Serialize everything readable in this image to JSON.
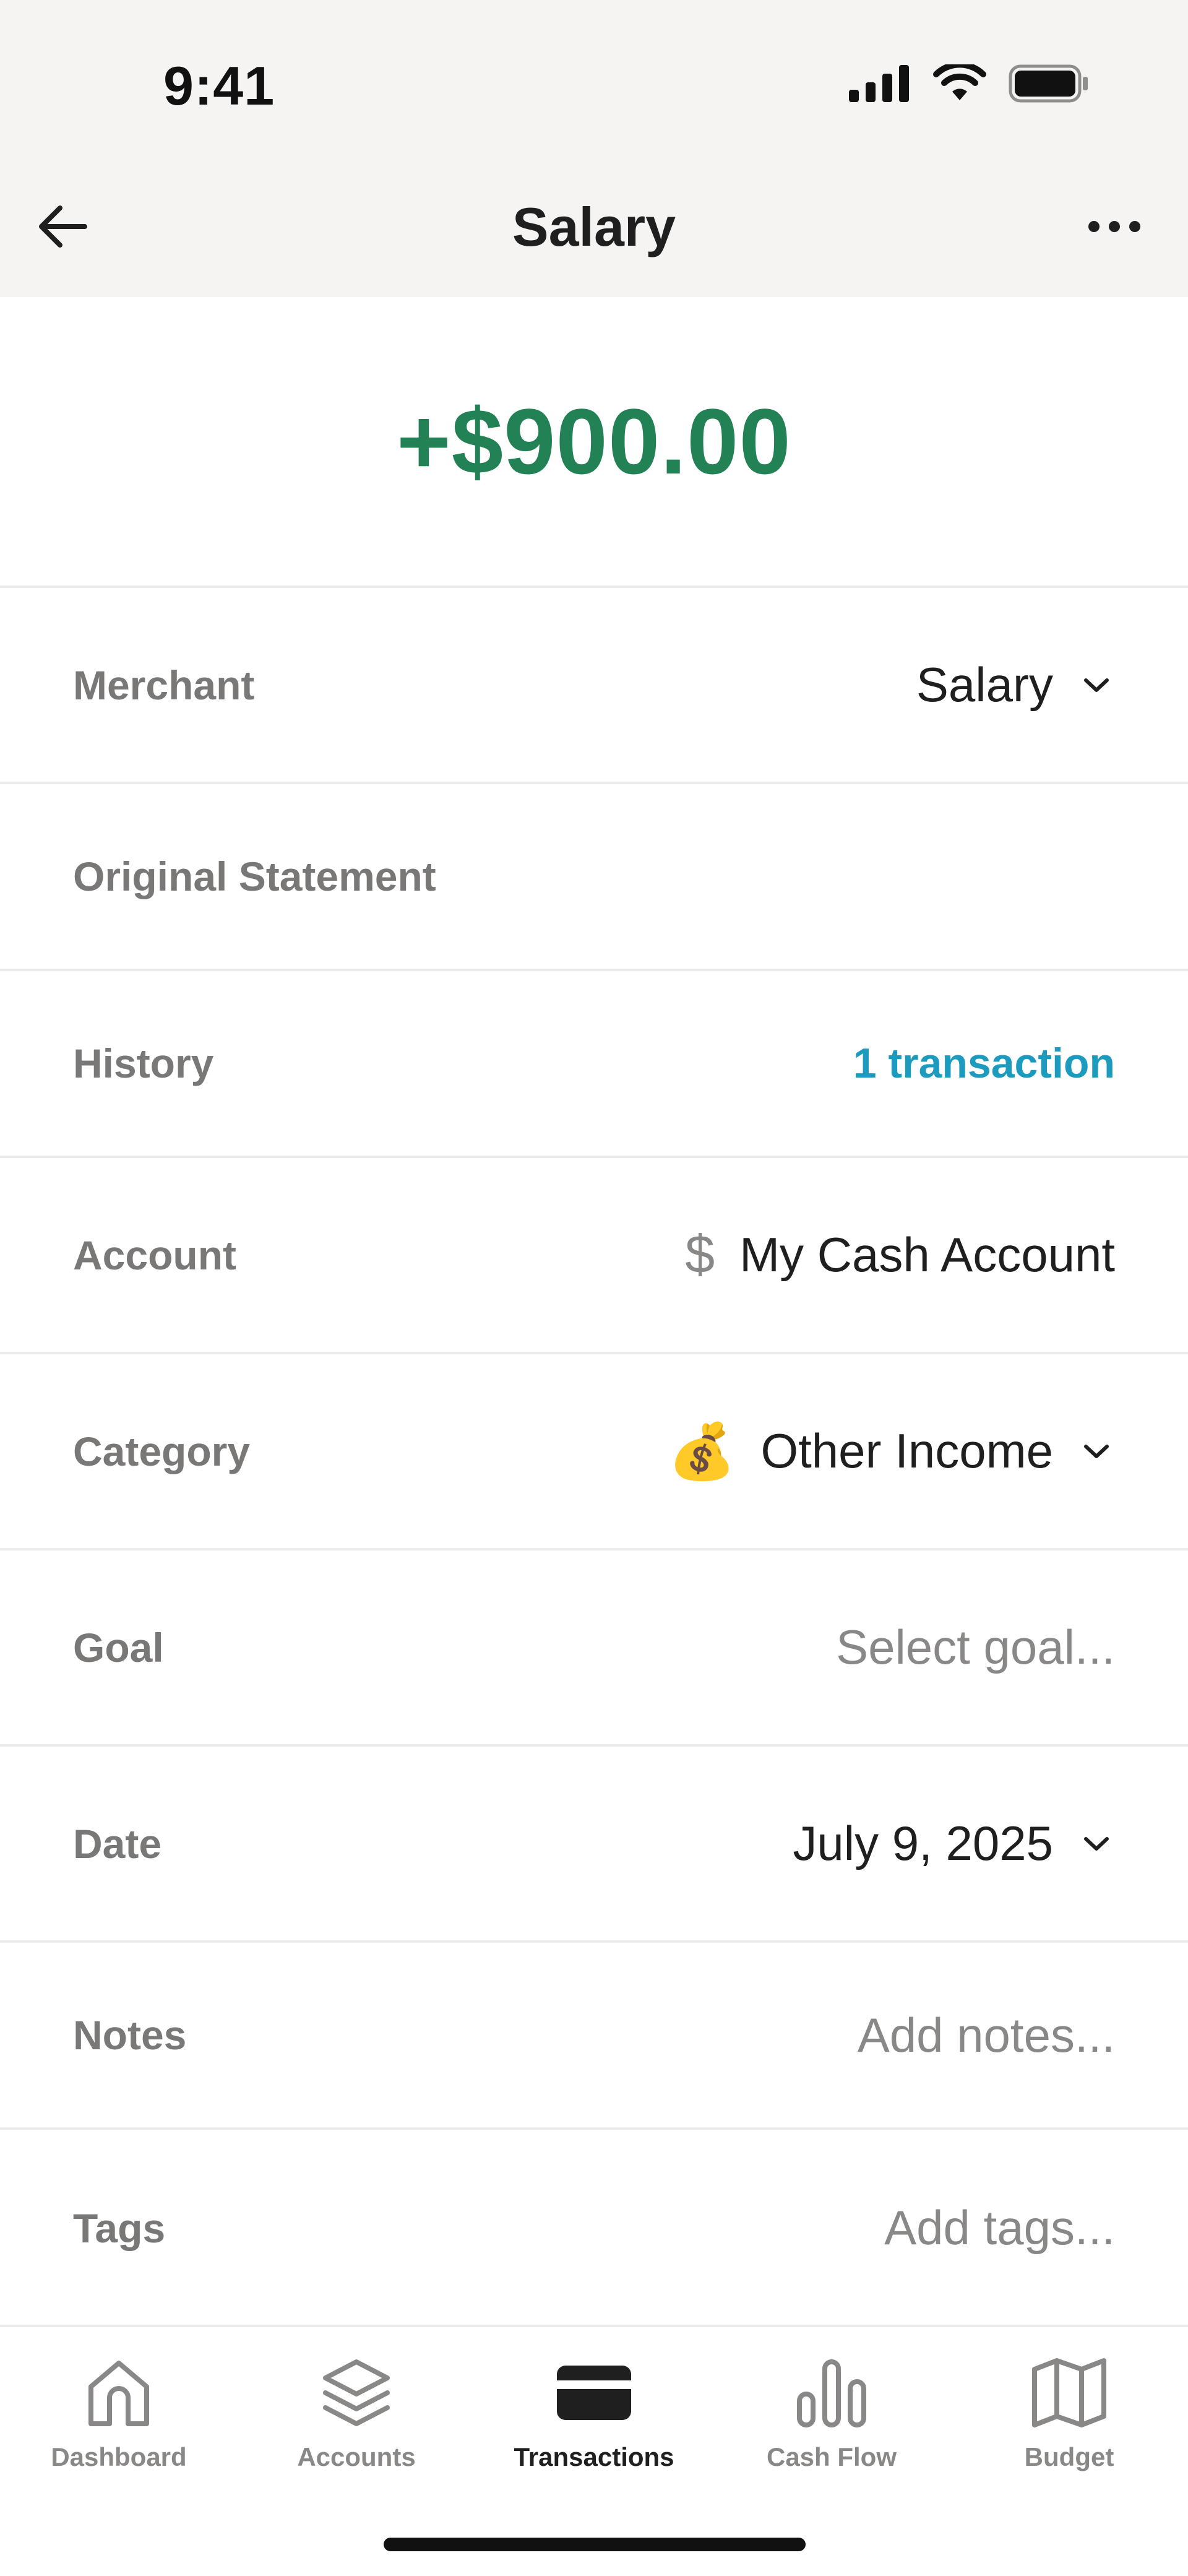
{
  "status_bar": {
    "time": "9:41"
  },
  "header": {
    "title": "Salary"
  },
  "amount": "+$900.00",
  "colors": {
    "amount": "#228155",
    "link": "#1c9bbf",
    "label": "#7a7876"
  },
  "rows": {
    "merchant": {
      "label": "Merchant",
      "value": "Salary"
    },
    "original_statement": {
      "label": "Original Statement"
    },
    "history": {
      "label": "History",
      "value": "1 transaction"
    },
    "account": {
      "label": "Account",
      "icon": "$",
      "value": "My Cash Account"
    },
    "category": {
      "label": "Category",
      "icon": "💰",
      "value": "Other Income"
    },
    "goal": {
      "label": "Goal",
      "placeholder": "Select goal..."
    },
    "date": {
      "label": "Date",
      "value": "July 9, 2025"
    },
    "notes": {
      "label": "Notes",
      "placeholder": "Add notes..."
    },
    "tags": {
      "label": "Tags",
      "placeholder": "Add tags..."
    }
  },
  "tabs": [
    {
      "label": "Dashboard",
      "icon": "home-icon"
    },
    {
      "label": "Accounts",
      "icon": "layers-icon"
    },
    {
      "label": "Transactions",
      "icon": "card-icon",
      "active": true
    },
    {
      "label": "Cash Flow",
      "icon": "bar-chart-icon"
    },
    {
      "label": "Budget",
      "icon": "map-icon"
    }
  ]
}
